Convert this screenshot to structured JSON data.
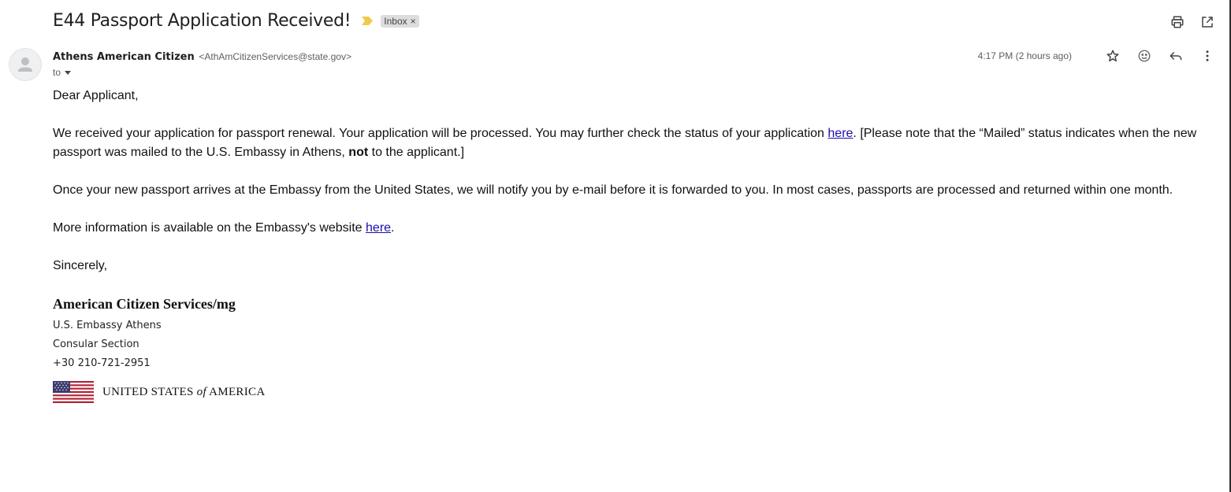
{
  "subject": "E44 Passport Application Received!",
  "label": "Inbox",
  "label_remove": "×",
  "sender": {
    "name": "Athens American Citizen",
    "email": "<AthAmCitizenServices@state.gov>"
  },
  "to_label": "to",
  "timestamp": "4:17 PM (2 hours ago)",
  "body": {
    "greeting": "Dear Applicant,",
    "p1_a": "We received your application for passport renewal.  Your application will be processed.  ",
    "p1_b": "You may further check the status of your application",
    "p1_link": "here",
    "p1_c": ".  [Please note that the “Mailed” status indicates when the new passport was mailed to the U.S. Embassy in Athens, ",
    "p1_bold": "not",
    "p1_d": " to the applicant.]",
    "p2": "Once your new passport arrives at the Embassy from the United States, we will notify you by e-mail before it is forwarded to you.  In most cases, passports are processed and returned within one month.",
    "p3_a": "More information is available on the Embassy's website ",
    "p3_link": "here",
    "p3_b": ".",
    "closing": "Sincerely,"
  },
  "signature": {
    "org": "American Citizen Services/mg",
    "line1": "U.S. Embassy Athens",
    "line2": "Consular Section",
    "line3": "+30 210-721-2951",
    "logo_text_a": "UNITED STATES ",
    "logo_text_of": "of",
    "logo_text_b": " AMERICA"
  },
  "colors": {
    "importance": "#f2c94c",
    "link": "#1a0dab",
    "chip_bg": "#dddddd"
  },
  "icons": [
    "print-icon",
    "open-in-new-window-icon",
    "star-icon",
    "emoji-react-icon",
    "reply-icon",
    "more-vertical-icon",
    "avatar-person-icon",
    "dropdown-arrow-icon",
    "importance-marker-icon",
    "us-flag-icon"
  ]
}
